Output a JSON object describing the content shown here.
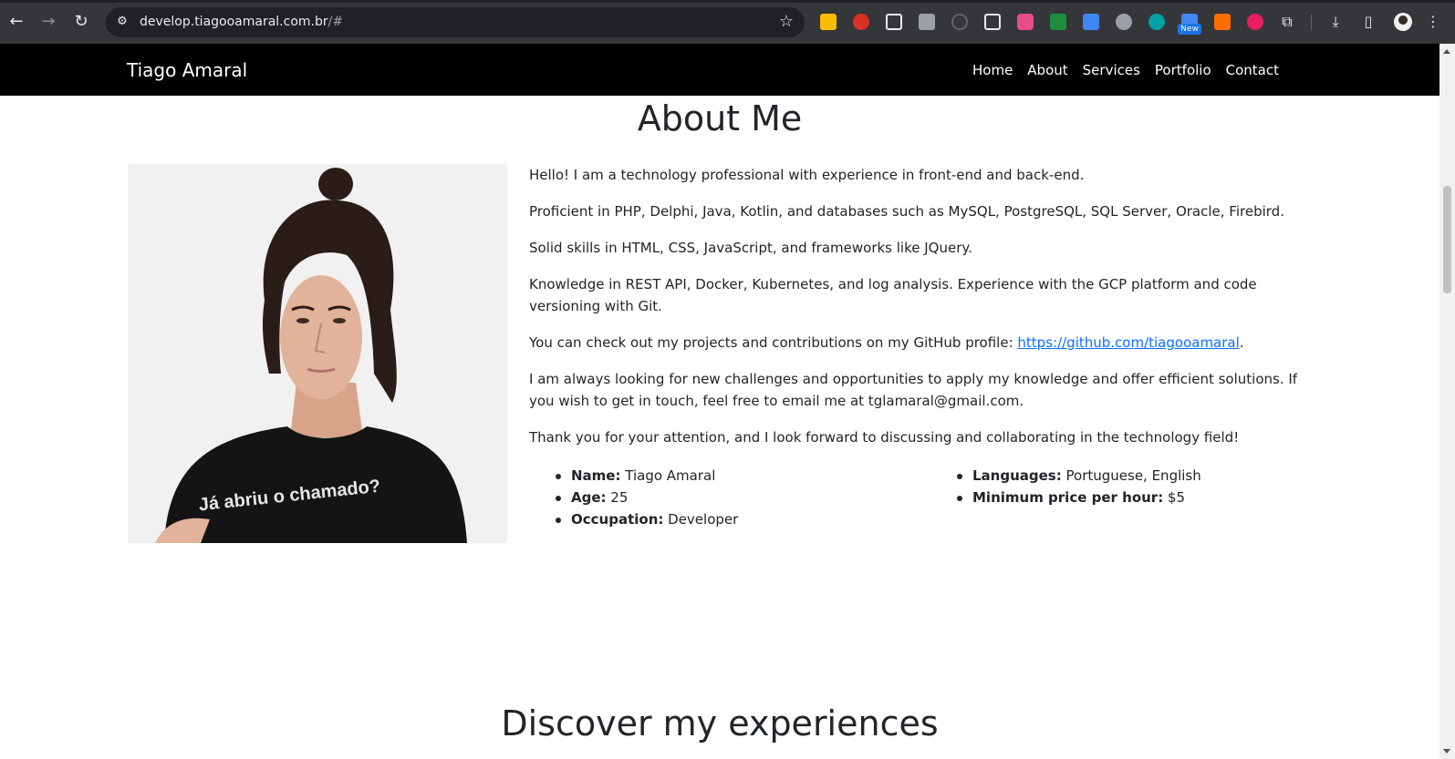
{
  "browser": {
    "url_main": "develop.tiagooamaral.com.br",
    "url_suffix": "/#",
    "new_badge": "New",
    "icons": {
      "back": "back-arrow-icon",
      "forward": "forward-arrow-icon",
      "reload": "reload-icon",
      "site_info": "site-settings-icon",
      "bookmark": "star-icon",
      "download": "download-icon",
      "side_panel": "side-panel-icon",
      "extensions": "puzzle-icon",
      "menu": "kebab-menu-icon"
    },
    "extension_colors": [
      "#fbbc04",
      "#d93025",
      "#e8eaed",
      "#e8eaed",
      "#5f6368",
      "#e8eaed",
      "#ea4c89",
      "#1e8e3e",
      "#4285f4",
      "#e8eaed",
      "#00a2a5",
      "#4285f4",
      "#ff6f00",
      "#e91e63"
    ]
  },
  "site": {
    "brand": "Tiago Amaral",
    "menu": [
      "Home",
      "About",
      "Services",
      "Portfolio",
      "Contact"
    ]
  },
  "about": {
    "title": "About Me",
    "p1": "Hello! I am a technology professional with experience in front-end and back-end.",
    "p2": "Proficient in PHP, Delphi, Java, Kotlin, and databases such as MySQL, PostgreSQL, SQL Server, Oracle, Firebird.",
    "p3": "Solid skills in HTML, CSS, JavaScript, and frameworks like JQuery.",
    "p4": "Knowledge in REST API, Docker, Kubernetes, and log analysis. Experience with the GCP platform and code versioning with Git.",
    "p5_prefix": "You can check out my projects and contributions on my GitHub profile: ",
    "p5_link": "https://github.com/tiagooamaral",
    "p5_suffix": ".",
    "p6": "I am always looking for new challenges and opportunities to apply my knowledge and offer efficient solutions. If you wish to get in touch, feel free to email me at tglamaral@gmail.com.",
    "p7": "Thank you for your attention, and I look forward to discussing and collaborating in the technology field!",
    "photo_shirt_text": "Já abriu o chamado?",
    "info_left": [
      {
        "label": "Name:",
        "value": " Tiago Amaral"
      },
      {
        "label": "Age:",
        "value": " 25"
      },
      {
        "label": "Occupation:",
        "value": " Developer"
      }
    ],
    "info_right": [
      {
        "label": "Languages:",
        "value": " Portuguese, English"
      },
      {
        "label": "Minimum price per hour:",
        "value": " $5"
      }
    ]
  },
  "experience": {
    "title": "Discover my experiences"
  }
}
